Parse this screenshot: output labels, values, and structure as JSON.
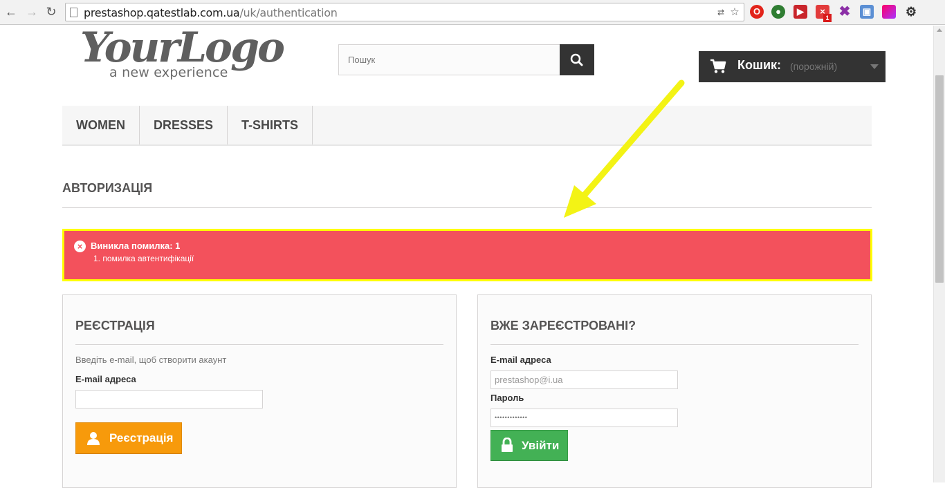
{
  "browser": {
    "url_host": "prestashop.qatestlab.com.ua",
    "url_path": "/uk/authentication",
    "extension_badge": "1"
  },
  "header": {
    "logo_main": "YourLogo",
    "logo_sub": "a new experience",
    "search_placeholder": "Пошук",
    "cart_label": "Кошик:",
    "cart_status": "(порожній)"
  },
  "menu": {
    "items": [
      "WOMEN",
      "DRESSES",
      "T-SHIRTS"
    ]
  },
  "page": {
    "heading": "АВТОРИЗАЦІЯ"
  },
  "alert": {
    "title": "Виникла помилка: 1",
    "items": [
      "1. помилка автентифікації"
    ],
    "color": "#f3515c",
    "highlight": "#ffff00"
  },
  "register": {
    "title": "РЕЄСТРАЦІЯ",
    "hint": "Введіть e-mail, щоб створити акаунт",
    "email_label": "E-mail адреса",
    "email_value": "",
    "button_label": "Реєстрація",
    "button_color": "#f79a0b"
  },
  "login": {
    "title": "ВЖЕ ЗАРЕЄСТРОВАНІ?",
    "email_label": "E-mail адреса",
    "email_value": "prestashop@i.ua",
    "password_label": "Пароль",
    "password_value": "•••••••••••••",
    "button_label": "Увійти",
    "button_color": "#43b155"
  }
}
